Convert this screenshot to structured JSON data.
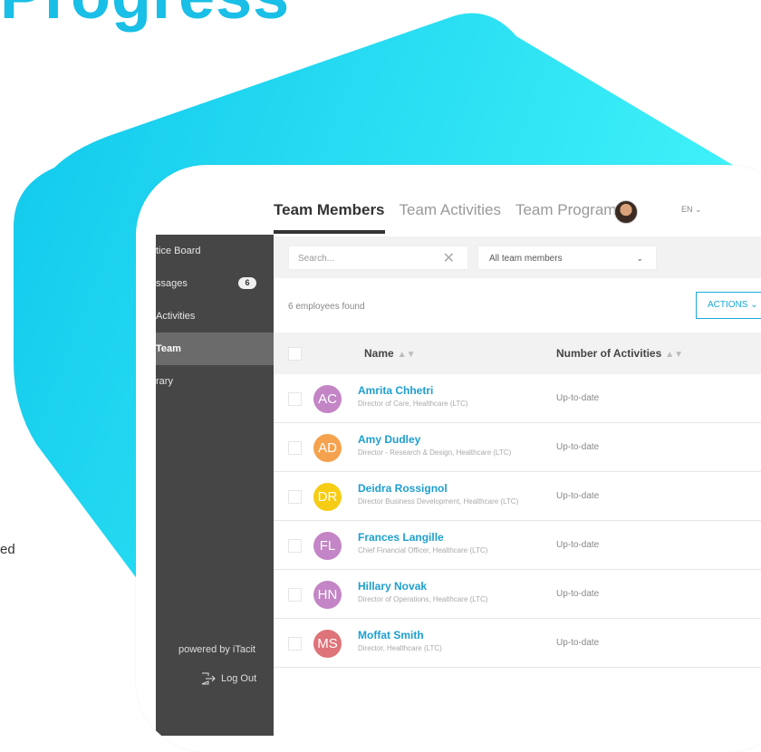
{
  "hero": {
    "title_fragment": "Progress",
    "side_caption": "ed"
  },
  "tabs": [
    {
      "label": "Team Members",
      "active": true
    },
    {
      "label": "Team Activities",
      "active": false
    },
    {
      "label": "Team Programs",
      "active": false
    }
  ],
  "header": {
    "language": "EN ⌄"
  },
  "sidebar": {
    "items": [
      {
        "label": "tice Board",
        "active": false
      },
      {
        "label": "ssages",
        "active": false,
        "badge": "6"
      },
      {
        "label": "Activities",
        "active": false
      },
      {
        "label": "Team",
        "active": true
      },
      {
        "label": "rary",
        "active": false
      }
    ],
    "powered_by": "powered by iTacit",
    "logout_label": "Log Out"
  },
  "toolbar": {
    "search_placeholder": "Search...",
    "filter_value": "All team members"
  },
  "summary": {
    "count_text": "6 employees found",
    "actions_label": "ACTIONS"
  },
  "table": {
    "columns": [
      "Name",
      "Number of Activities"
    ],
    "rows": [
      {
        "initials": "AC",
        "name": "Amrita Chhetri",
        "title": "Director of Care, Healthcare (LTC)",
        "status": "Up-to-date",
        "color": "#c385c6"
      },
      {
        "initials": "AD",
        "name": "Amy Dudley",
        "title": "Director - Research & Design, Healthcare (LTC)",
        "status": "Up-to-date",
        "color": "#f5a24f"
      },
      {
        "initials": "DR",
        "name": "Deidra Rossignol",
        "title": "Director Business Development, Healthcare (LTC)",
        "status": "Up-to-date",
        "color": "#f7cc14"
      },
      {
        "initials": "FL",
        "name": "Frances Langille",
        "title": "Chief Financial Officer, Healthcare (LTC)",
        "status": "Up-to-date",
        "color": "#c385c6"
      },
      {
        "initials": "HN",
        "name": "Hillary Novak",
        "title": "Director of Operations, Healthcare (LTC)",
        "status": "Up-to-date",
        "color": "#c385c6"
      },
      {
        "initials": "MS",
        "name": "Moffat Smith",
        "title": "Director, Healthcare (LTC)",
        "status": "Up-to-date",
        "color": "#de7379"
      }
    ]
  },
  "colors": {
    "accent": "#19bfe6",
    "link": "#1d9fd0",
    "sidebar_bg": "#464646"
  }
}
